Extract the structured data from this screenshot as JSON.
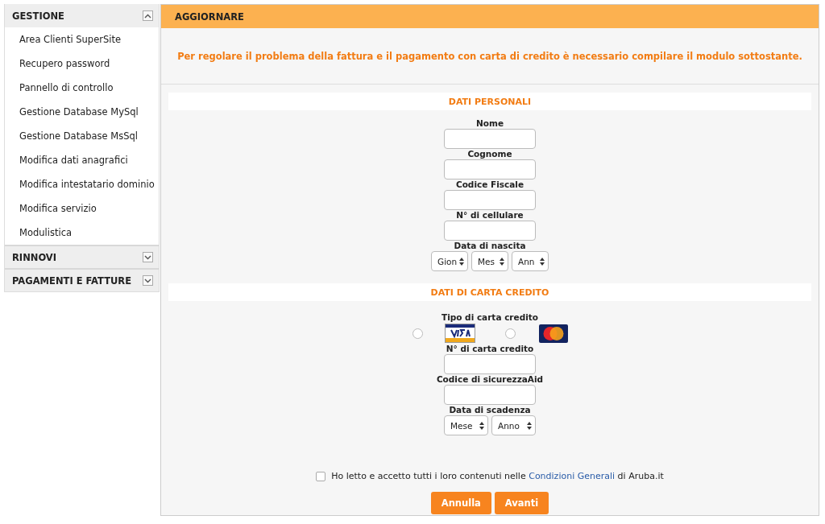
{
  "sidebar": {
    "sections": [
      {
        "title": "GESTIONE",
        "expanded": true,
        "items": [
          "Area Clienti SuperSite",
          "Recupero password",
          "Pannello di controllo",
          "Gestione Database MySql",
          "Gestione Database MsSql",
          "Modifica dati anagrafici",
          "Modifica intestatario dominio",
          "Modifica servizio",
          "Modulistica"
        ]
      },
      {
        "title": "RINNOVI",
        "expanded": false
      },
      {
        "title": "PAGAMENTI E FATTURE",
        "expanded": false
      }
    ]
  },
  "header": {
    "title": "AGGIORNARE"
  },
  "intro": "Per regolare il problema della fattura e il pagamento con carta di credito è necessario compilare il modulo sottostante.",
  "personal": {
    "title": "DATI PERSONALI",
    "fields": [
      {
        "kind": "text",
        "label": "Nome"
      },
      {
        "kind": "text",
        "label": "Cognome"
      },
      {
        "kind": "text",
        "label": "Codice Fiscale"
      },
      {
        "kind": "text",
        "label": "N° di cellulare"
      },
      {
        "kind": "selects",
        "label": "Data di nascita",
        "selects": [
          "Gion",
          "Mes",
          "Ann"
        ]
      }
    ]
  },
  "card": {
    "title": "DATI DI CARTA CREDITO",
    "type_label": "Tipo di carta credito",
    "card_types": [
      {
        "kind": "visa",
        "selected": false
      },
      {
        "kind": "mastercard",
        "selected": false
      }
    ],
    "fields": [
      {
        "kind": "text",
        "label": "N° di carta credito"
      },
      {
        "kind": "text",
        "label": "Codice di sicurezzaAid"
      },
      {
        "kind": "selects",
        "label": "Data di scadenza",
        "selects": [
          "Mese",
          "Anno"
        ]
      }
    ]
  },
  "agreement": {
    "checked": false,
    "before": "Ho letto e accetto tutti i loro contenuti nelle ",
    "link": "Condizioni Generali",
    "after": " di Aruba.it"
  },
  "buttons": [
    "Annulla",
    "Avanti"
  ]
}
